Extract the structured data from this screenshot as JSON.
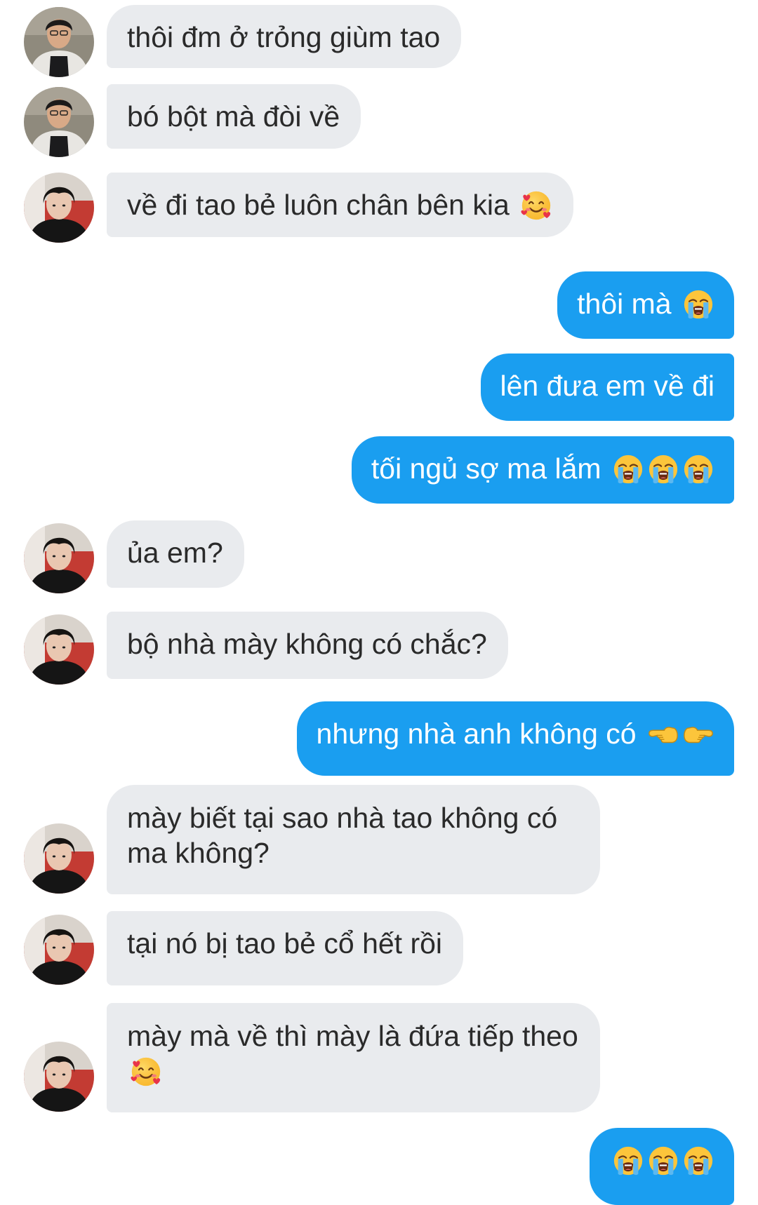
{
  "messages": [
    {
      "text": "thôi đm ở trỏng giùm tao",
      "emoji": []
    },
    {
      "text": "bó bột mà đòi về",
      "emoji": []
    },
    {
      "text": "về đi tao bẻ luôn chân bên kia",
      "emoji": [
        "smiling-face-with-hearts"
      ]
    },
    {
      "text": "thôi mà",
      "emoji": [
        "loudly-crying-face"
      ]
    },
    {
      "text": "lên đưa em về đi",
      "emoji": []
    },
    {
      "text": "tối ngủ sợ ma lắm",
      "emoji": [
        "loudly-crying-face",
        "loudly-crying-face",
        "loudly-crying-face"
      ]
    },
    {
      "text": "ủa em?",
      "emoji": []
    },
    {
      "text": "bộ nhà mày không có chắc?",
      "emoji": []
    },
    {
      "text": "nhưng nhà anh không có",
      "emoji": [
        "backhand-index-pointing-left",
        "backhand-index-pointing-right"
      ]
    },
    {
      "text": "mày biết tại sao nhà tao không có ma không?",
      "emoji": []
    },
    {
      "text": "tại nó bị tao bẻ cổ hết rồi",
      "emoji": []
    },
    {
      "text": "mày mà về thì mày là đứa tiếp theo",
      "emoji": [
        "smiling-face-with-hearts"
      ]
    },
    {
      "text": "",
      "emoji": [
        "loudly-crying-face",
        "loudly-crying-face",
        "loudly-crying-face"
      ]
    }
  ],
  "colors": {
    "incoming_bubble": "#e9ebee",
    "outgoing_bubble": "#1a9ef0",
    "incoming_text": "#2a2a2a",
    "outgoing_text": "#ffffff"
  },
  "icons": {
    "avatar_a": "avatar-photo-hoodie",
    "avatar_b": "avatar-photo-black-shirt"
  }
}
